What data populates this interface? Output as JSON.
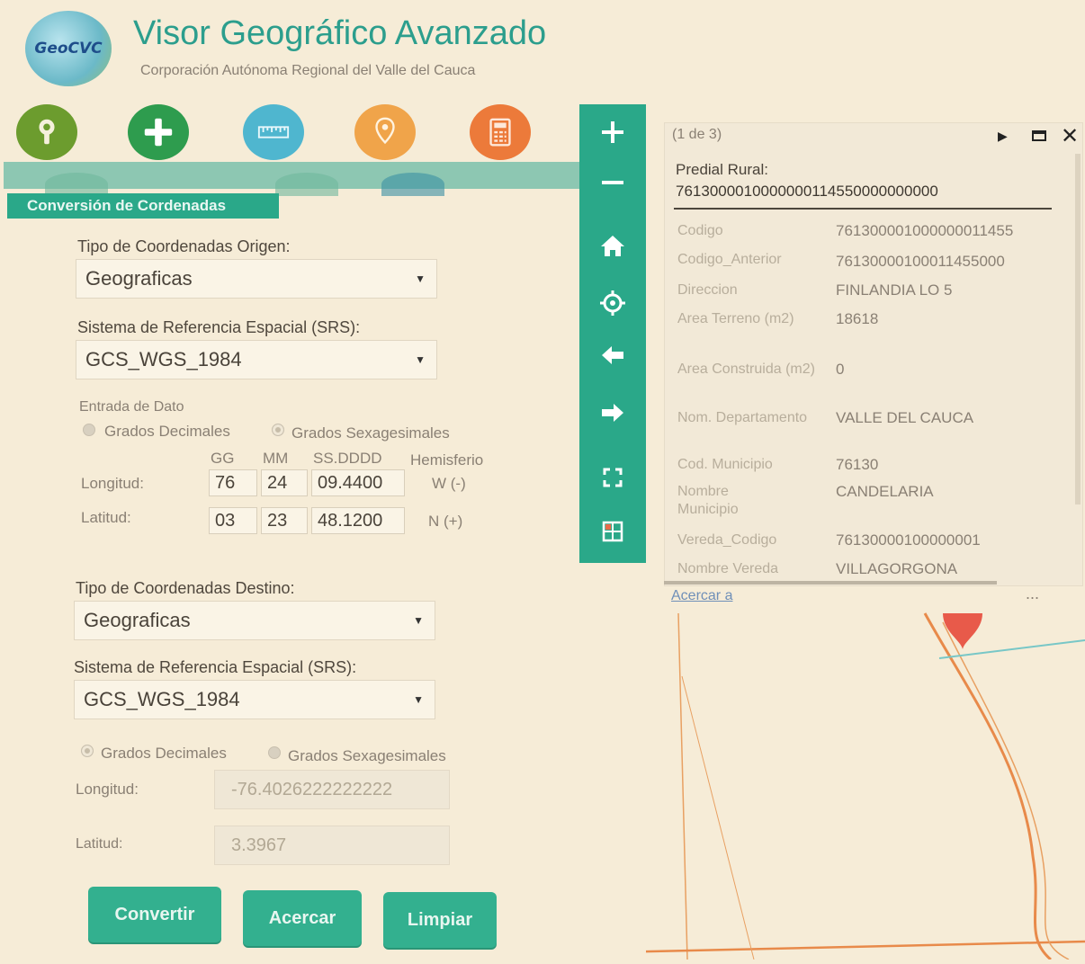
{
  "header": {
    "logo_text": "GeoCVC",
    "title": "Visor Geográfico Avanzado",
    "subtitle": "Corporación Autónoma Regional del Valle del Cauca"
  },
  "tools": [
    {
      "name": "info-tool",
      "color": "#6c9c2e",
      "icon": "pin-icon"
    },
    {
      "name": "add-tool",
      "color": "#2e9c4e",
      "icon": "plus-icon"
    },
    {
      "name": "measure-tool",
      "color": "#4fb6cf",
      "icon": "ruler-icon"
    },
    {
      "name": "locate-tool",
      "color": "#f0a44a",
      "icon": "location-pin-icon"
    },
    {
      "name": "calculator-tool",
      "color": "#ec7a3a",
      "icon": "calculator-icon"
    }
  ],
  "panel": {
    "title": "Conversión de Cordenadas",
    "origin_type_label": "Tipo de Coordenadas Origen:",
    "origin_type_value": "Geograficas",
    "origin_srs_label": "Sistema de Referencia Espacial (SRS):",
    "origin_srs_value": "GCS_WGS_1984",
    "input_label": "Entrada de Dato",
    "radio_decimal": "Grados Decimales",
    "radio_sexagesimal": "Grados Sexagesimales",
    "col_gg": "GG",
    "col_mm": "MM",
    "col_ss": "SS.DDDD",
    "col_hem": "Hemisferio",
    "lon_label": "Longitud:",
    "lon_gg": "76",
    "lon_mm": "24",
    "lon_ss": "09.4400",
    "lon_hem": "W (-)",
    "lat_label": "Latitud:",
    "lat_gg": "03",
    "lat_mm": "23",
    "lat_ss": "48.1200",
    "lat_hem": "N (+)",
    "dest_type_label": "Tipo de Coordenadas Destino:",
    "dest_type_value": "Geograficas",
    "dest_srs_label": "Sistema de Referencia Espacial (SRS):",
    "dest_srs_value": "GCS_WGS_1984",
    "dest_radio_decimal": "Grados Decimales",
    "dest_radio_sexagesimal": "Grados Sexagesimales",
    "dest_lon_label": "Longitud:",
    "dest_lon_value": "-76.4026222222222",
    "dest_lat_label": "Latitud:",
    "dest_lat_value": "3.3967",
    "btn_convert": "Convertir",
    "btn_zoom": "Acercar",
    "btn_clear": "Limpiar"
  },
  "map_toolbar": [
    "zoom-in-icon",
    "zoom-out-icon",
    "home-icon",
    "locate-icon",
    "back-arrow-icon",
    "forward-arrow-icon",
    "fullscreen-icon",
    "layers-icon"
  ],
  "popup": {
    "pager": "(1 de 3)",
    "title_line1": "Predial Rural:",
    "title_line2": "7613000010000000114550000000000",
    "attributes": [
      {
        "name": "Codigo",
        "value": "761300001000000011455"
      },
      {
        "name": "Codigo_Anterior",
        "value": "76130000100011455000"
      },
      {
        "name": "Direccion",
        "value": "FINLANDIA LO 5"
      },
      {
        "name": "Area Terreno (m2)",
        "value": "18618"
      },
      {
        "name": "Area Construida (m2)",
        "value": "0"
      },
      {
        "name": "Nom. Departamento",
        "value": "VALLE DEL CAUCA"
      },
      {
        "name": "Cod. Municipio",
        "value": "76130"
      },
      {
        "name": "Nombre Municipio",
        "value": "CANDELARIA"
      },
      {
        "name": "Vereda_Codigo",
        "value": "76130000100000001"
      },
      {
        "name": "Nombre Vereda",
        "value": "VILLAGORGONA"
      }
    ],
    "zoom_link": "Acercar a",
    "more": "..."
  }
}
